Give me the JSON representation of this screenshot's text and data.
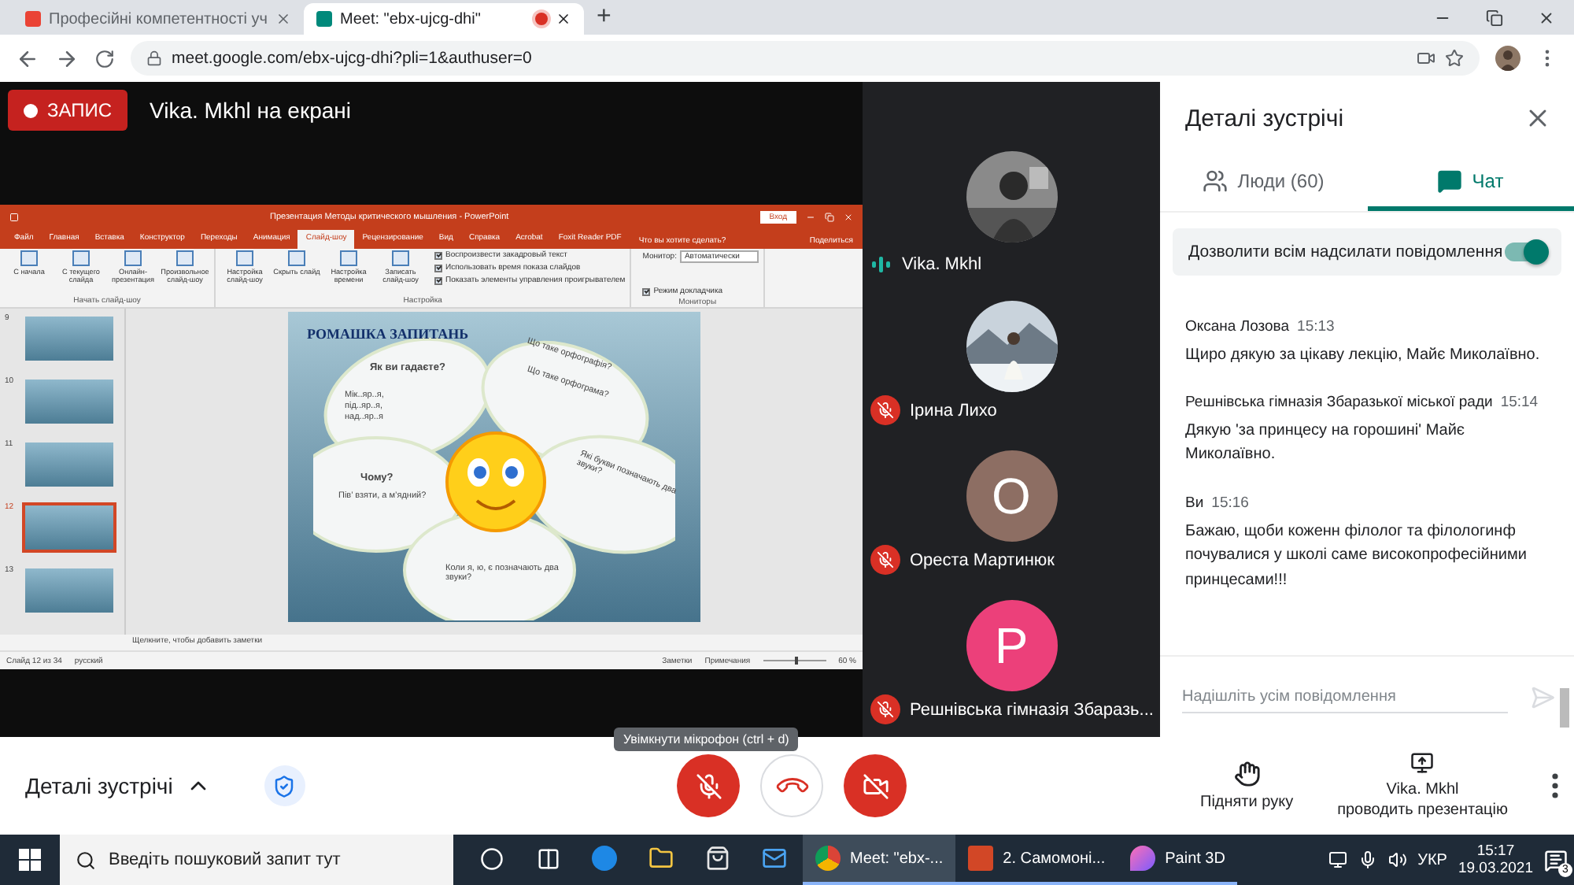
{
  "browser": {
    "tabs": [
      {
        "title": "Професійні компетентності уч",
        "selected": false,
        "recording": false
      },
      {
        "title": "Meet: \"ebx-ujcg-dhi\"",
        "selected": true,
        "recording": true
      }
    ],
    "new_tab": "+",
    "url": "meet.google.com/ebx-ujcg-dhi?pli=1&authuser=0"
  },
  "meet": {
    "record_label": "ЗАПИС",
    "presenter": "Vika. Mkhl на екрані",
    "shared_screen": {
      "title": "Презентация Методы критического мышления - PowerPoint",
      "signin": "Вход",
      "tabs": [
        {
          "label": "Файл",
          "selected": false
        },
        {
          "label": "Главная",
          "selected": false
        },
        {
          "label": "Вставка",
          "selected": false
        },
        {
          "label": "Конструктор",
          "selected": false
        },
        {
          "label": "Переходы",
          "selected": false
        },
        {
          "label": "Анимация",
          "selected": false
        },
        {
          "label": "Слайд-шоу",
          "selected": true
        },
        {
          "label": "Рецензирование",
          "selected": false
        },
        {
          "label": "Вид",
          "selected": false
        },
        {
          "label": "Справка",
          "selected": false
        },
        {
          "label": "Acrobat",
          "selected": false
        },
        {
          "label": "Foxit Reader PDF",
          "selected": false
        }
      ],
      "tell_me": "Что вы хотите сделать?",
      "share": "Поделиться",
      "ribbon_groups": [
        {
          "label": "Начать слайд-шоу",
          "buttons": [
            "С начала",
            "С текущего слайда",
            "Онлайн-презентация",
            "Произвольное слайд-шоу"
          ]
        },
        {
          "label": "Настройка",
          "buttons": [
            "Настройка слайд-шоу",
            "Скрыть слайд",
            "Настройка времени",
            "Записать слайд-шоу"
          ],
          "checks": [
            {
              "label": "Воспроизвести закадровый текст",
              "checked": true
            },
            {
              "label": "Использовать время показа слайдов",
              "checked": true
            },
            {
              "label": "Показать элементы управления проигрывателем",
              "checked": true
            }
          ]
        },
        {
          "label": "Мониторы",
          "select": {
            "label": "Монитор:",
            "value": "Автоматически"
          },
          "checks": [
            {
              "label": "Режим докладчика",
              "checked": true
            }
          ]
        }
      ],
      "thumbnails": [
        {
          "number": "9",
          "selected": false
        },
        {
          "number": "10",
          "selected": false
        },
        {
          "number": "11",
          "selected": false
        },
        {
          "number": "12",
          "selected": true
        },
        {
          "number": "13",
          "selected": false
        }
      ],
      "slide": {
        "title": "РОМАШКА ЗАПИТАНЬ",
        "texts": [
          {
            "text": "Як ви гадаєте?",
            "kind": "heading"
          },
          {
            "text": "Мік..яр..я,",
            "kind": "body"
          },
          {
            "text": "під..яр..я,",
            "kind": "body"
          },
          {
            "text": "над..яр..я",
            "kind": "body"
          },
          {
            "text": "Що таке орфографія?",
            "kind": "tilted"
          },
          {
            "text": "Що таке орфограма?",
            "kind": "tilted"
          },
          {
            "text": "Чому?",
            "kind": "heading"
          },
          {
            "text": "Пів’ взяти, а м’ядний?",
            "kind": "body"
          },
          {
            "text": "Які букви позначають два звуки?",
            "kind": "tilted"
          },
          {
            "text": "Коли я, ю, є позначають два звуки?",
            "kind": "body"
          }
        ]
      },
      "notes": "Щелкните, чтобы добавить заметки",
      "status": {
        "slide": "Слайд 12 из 34",
        "language": "русский",
        "notes": "Заметки",
        "comments": "Примечания",
        "zoom": "60 %",
        "level": 0.5
      }
    },
    "tiles": [
      {
        "name": "Vika. Mkhl",
        "muted": false
      },
      {
        "name": "Ірина Лихо",
        "muted": true
      },
      {
        "name": "Ореста Мартинюк",
        "muted": true,
        "kind": "letter",
        "letter": "O",
        "color": "#8d6e63"
      },
      {
        "name": "Решнівська гімназія Збаразь...",
        "muted": true,
        "kind": "letter",
        "letter": "P",
        "color": "#ec407a"
      }
    ],
    "panel": {
      "title": "Деталі зустрічі",
      "tabs": [
        {
          "label": "Люди (60)",
          "kind": "people",
          "selected": false
        },
        {
          "label": "Чат",
          "kind": "chat",
          "selected": true
        }
      ],
      "allow": {
        "label": "Дозволити всім надсилати повідомлення",
        "on": true
      },
      "messages": [
        {
          "author": "Оксана Лозова",
          "time": "15:13",
          "text": "Щиро дякую за цікаву лекцію, Майє Миколаївно."
        },
        {
          "author": "Решнівська гімназія Збаразької міської ради",
          "time": "15:14",
          "text": "Дякую 'за принцесу на горошині' Майє Миколаївно."
        },
        {
          "author": "Ви",
          "time": "15:16",
          "text": "Бажаю, щоби коженн філолог та філологинф почувалися у школі саме високопрофесійними принцесами!!!"
        }
      ],
      "placeholder": "Надішліть усім повідомлення"
    },
    "controls": {
      "details": "Деталі зустрічі",
      "mic_muted": true,
      "camera_off": true,
      "raise_hand": "Підняти руку",
      "presenting_name": "Vika. Mkhl",
      "presenting": "проводить презентацію"
    },
    "tooltip": "Увімкнути мікрофон (ctrl + d)"
  },
  "taskbar": {
    "search": "Введіть пошуковий запит тут",
    "apps": [
      {
        "kind": "cortana",
        "selected": false
      },
      {
        "kind": "taskview",
        "selected": false
      },
      {
        "kind": "edge",
        "selected": false
      },
      {
        "kind": "explorer",
        "selected": false
      },
      {
        "kind": "store",
        "selected": false
      },
      {
        "kind": "mail",
        "selected": false
      },
      {
        "kind": "chrome",
        "label": "Meet: \"ebx-...",
        "selected": true
      },
      {
        "kind": "powerpoint",
        "label": "2. Самомоні...",
        "selected": false
      },
      {
        "kind": "paint",
        "label": "Paint 3D",
        "selected": false
      }
    ],
    "language": "УКР",
    "time": "15:17",
    "date": "19.03.2021",
    "notifications": "3"
  }
}
